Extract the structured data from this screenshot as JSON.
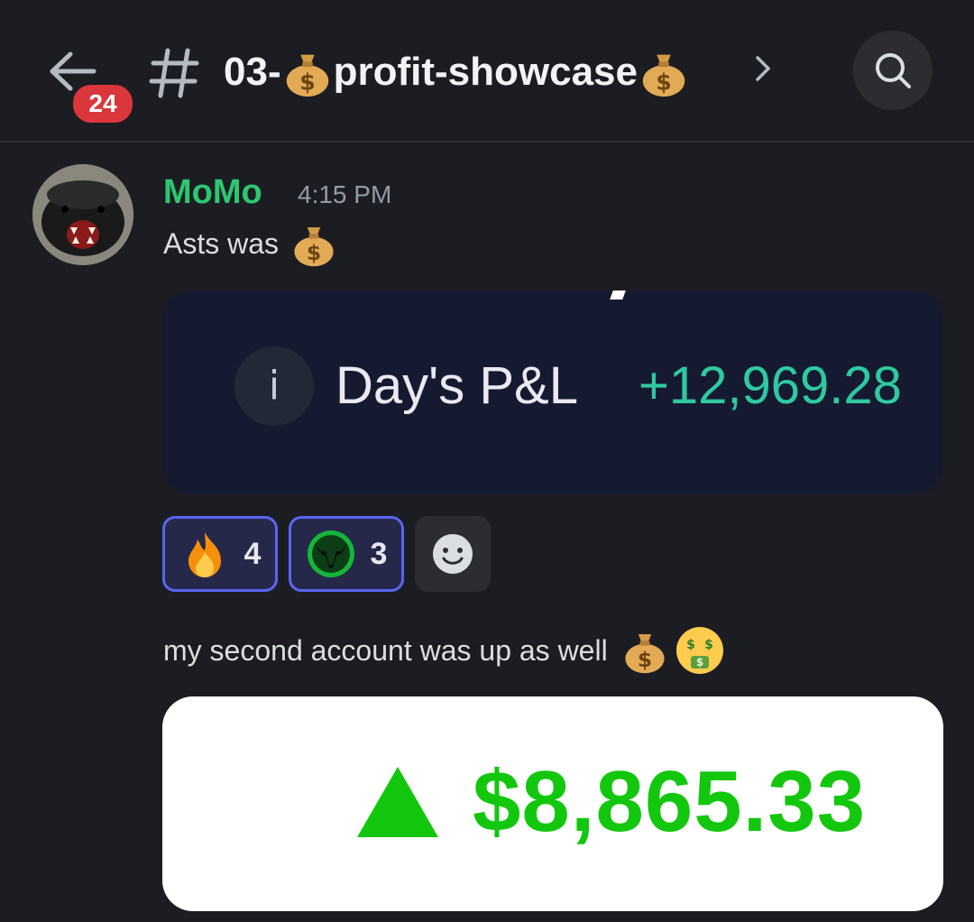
{
  "header": {
    "unread_count": "24",
    "channel_name_prefix": "03-",
    "channel_name_main": "profit-showcase",
    "icons": [
      "back-arrow-icon",
      "hashtag-icon",
      "money-bag-icon",
      "chevron-right-icon",
      "search-icon"
    ]
  },
  "message": {
    "author": "MoMo",
    "time": "4:15 PM",
    "text1": "Asts was",
    "card1": {
      "label": "Day's P&L",
      "value": "+12,969.28",
      "info_glyph": "i"
    },
    "reactions": [
      {
        "emoji": "fire",
        "count": "4"
      },
      {
        "emoji": "bull-badge",
        "count": "3"
      }
    ],
    "text2": "my second account was up as well",
    "card2": {
      "value": "$8,865.33"
    }
  },
  "colors": {
    "background": "#1c1d22",
    "username": "#2dc770",
    "pnl_positive": "#2fc9a0",
    "usd_green": "#13c70e",
    "badge_red": "#da373c",
    "reaction_border": "#5865f2"
  }
}
